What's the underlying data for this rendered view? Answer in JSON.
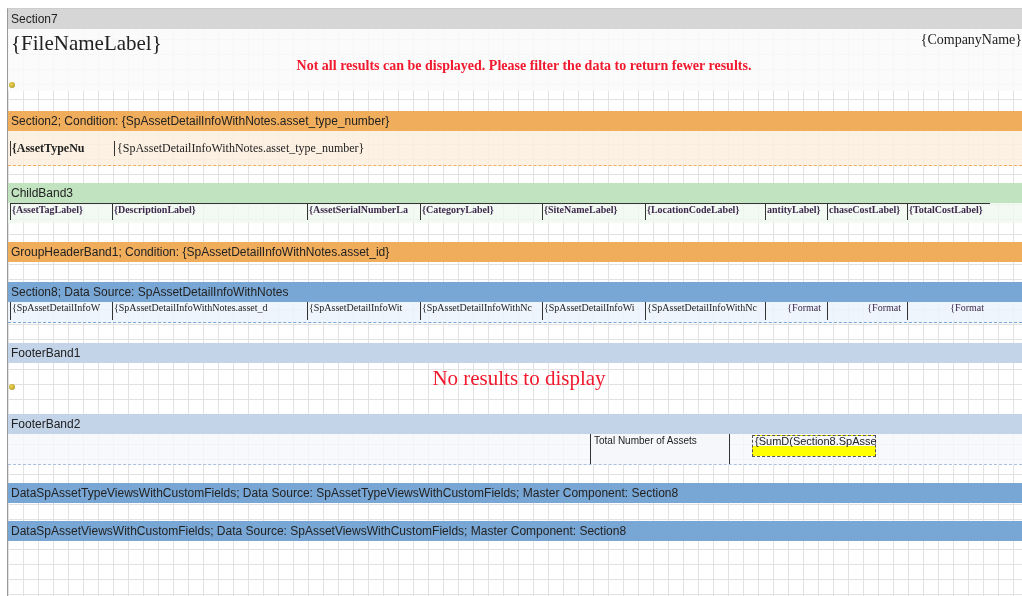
{
  "page_header": {
    "title": "Section7",
    "file_name": "{FileNameLabel}",
    "company": "{CompanyName}",
    "warning": "Not all results can be displayed. Please filter the data to return fewer results."
  },
  "group_band": {
    "title": "Section2; Condition: {SpAssetDetailInfoWithNotes.asset_type_number}",
    "label": "{AssetTypeNu",
    "value": "{SpAssetDetailInfoWithNotes.asset_type_number}"
  },
  "column_band": {
    "title": "ChildBand3",
    "columns": [
      "{AssetTagLabel}",
      "{DescriptionLabel}",
      "{AssetSerialNumberLa",
      "{CategoryLabel}",
      "{SiteNameLabel}",
      "{LocationCodeLabel}",
      "antityLabel}",
      "chaseCostLabel}",
      "{TotalCostLabel}"
    ]
  },
  "group_header": {
    "title": "GroupHeaderBand1; Condition: {SpAssetDetailInfoWithNotes.asset_id}"
  },
  "data_band": {
    "title": "Section8; Data Source: SpAssetDetailInfoWithNotes",
    "fields": [
      {
        "text": "{SpAssetDetailInfoW",
        "kind": "text"
      },
      {
        "text": "{SpAssetDetailInfoWithNotes.asset_d",
        "kind": "text"
      },
      {
        "text": "{SpAssetDetailInfoWit",
        "kind": "text"
      },
      {
        "text": "{SpAssetDetailInfoWithNc",
        "kind": "text"
      },
      {
        "text": "{SpAssetDetailInfoWi",
        "kind": "text"
      },
      {
        "text": "{SpAssetDetailInfoWithNc",
        "kind": "text"
      },
      {
        "text": "{Format",
        "kind": "number"
      },
      {
        "text": "{Format",
        "kind": "number"
      },
      {
        "text": "{Format",
        "kind": "number"
      }
    ]
  },
  "footer_band_1": {
    "title": "FooterBand1",
    "message": "No results to display"
  },
  "footer_band_2": {
    "title": "FooterBand2",
    "label": "Total Number of Assets",
    "total": {
      "text": "{SumD(Section8.SpAsse",
      "selected": true
    }
  },
  "detail_bands": [
    {
      "title": "DataSpAssetTypeViewsWithCustomFields; Data Source: SpAssetTypeViewsWithCustomFields; Master Component: Section8"
    },
    {
      "title": "DataSpAssetViewsWithCustomFields; Data Source: SpAssetViewsWithCustomFields; Master Component: Section8"
    }
  ]
}
